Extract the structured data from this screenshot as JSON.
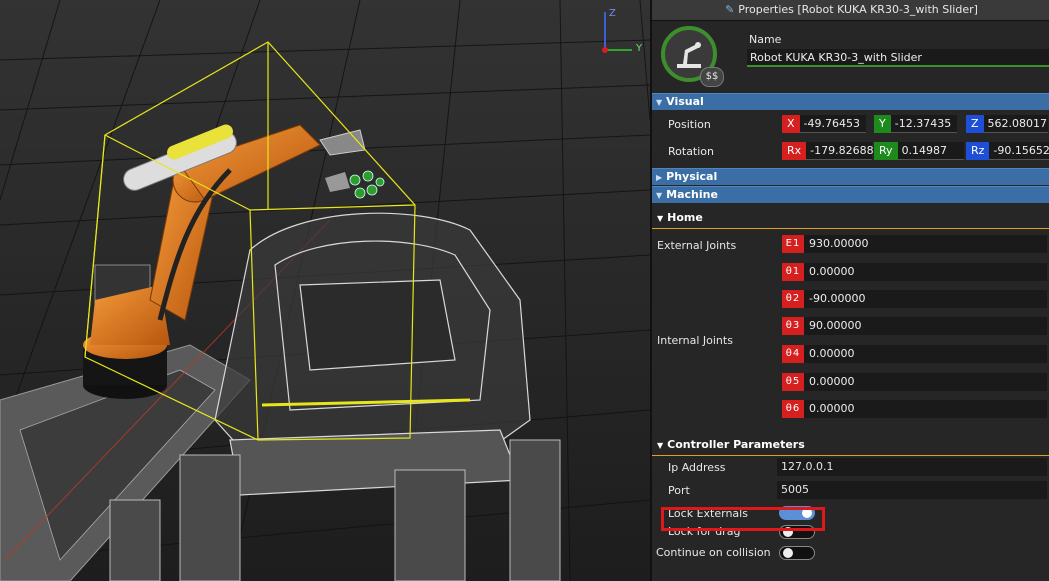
{
  "panel": {
    "title": "Properties [Robot  KUKA KR30-3_with Slider]",
    "name_label": "Name",
    "name_value": "Robot  KUKA KR30-3_with Slider",
    "logo_badge": "$$"
  },
  "sections": {
    "visual": "Visual",
    "physical": "Physical",
    "machine": "Machine"
  },
  "visual": {
    "position_label": "Position",
    "rotation_label": "Rotation",
    "position": {
      "x_tag": "X",
      "x": "-49.76453",
      "y_tag": "Y",
      "y": "-12.37435",
      "z_tag": "Z",
      "z": "562.08017"
    },
    "rotation": {
      "rx_tag": "Rx",
      "rx": "-179.82688",
      "ry_tag": "Ry",
      "ry": "0.14987",
      "rz_tag": "Rz",
      "rz": "-90.15652"
    }
  },
  "home": {
    "title": "Home",
    "external_label": "External Joints",
    "internal_label": "Internal Joints",
    "external": [
      {
        "tag": "E1",
        "value": "930.00000"
      }
    ],
    "internal": [
      {
        "tag": "θ1",
        "value": "0.00000"
      },
      {
        "tag": "θ2",
        "value": "-90.00000"
      },
      {
        "tag": "θ3",
        "value": "90.00000"
      },
      {
        "tag": "θ4",
        "value": "0.00000"
      },
      {
        "tag": "θ5",
        "value": "0.00000"
      },
      {
        "tag": "θ6",
        "value": "0.00000"
      }
    ]
  },
  "controller": {
    "title": "Controller Parameters",
    "ip_label": "Ip Address",
    "ip_value": "127.0.0.1",
    "port_label": "Port",
    "port_value": "5005",
    "lock_externals_label": "Lock Externals",
    "lock_externals": true,
    "lock_drag_label": "Lock for drag",
    "lock_drag": false,
    "continue_label": "Continue on collision",
    "continue_on_collision": false
  },
  "gizmo": {
    "z_label": "Z",
    "y_label": "Y"
  },
  "colors": {
    "accent": "#3b6ea5",
    "robot_orange": "#e07a1c",
    "selection_box": "#e6e61a",
    "highlight": "#e01818"
  }
}
